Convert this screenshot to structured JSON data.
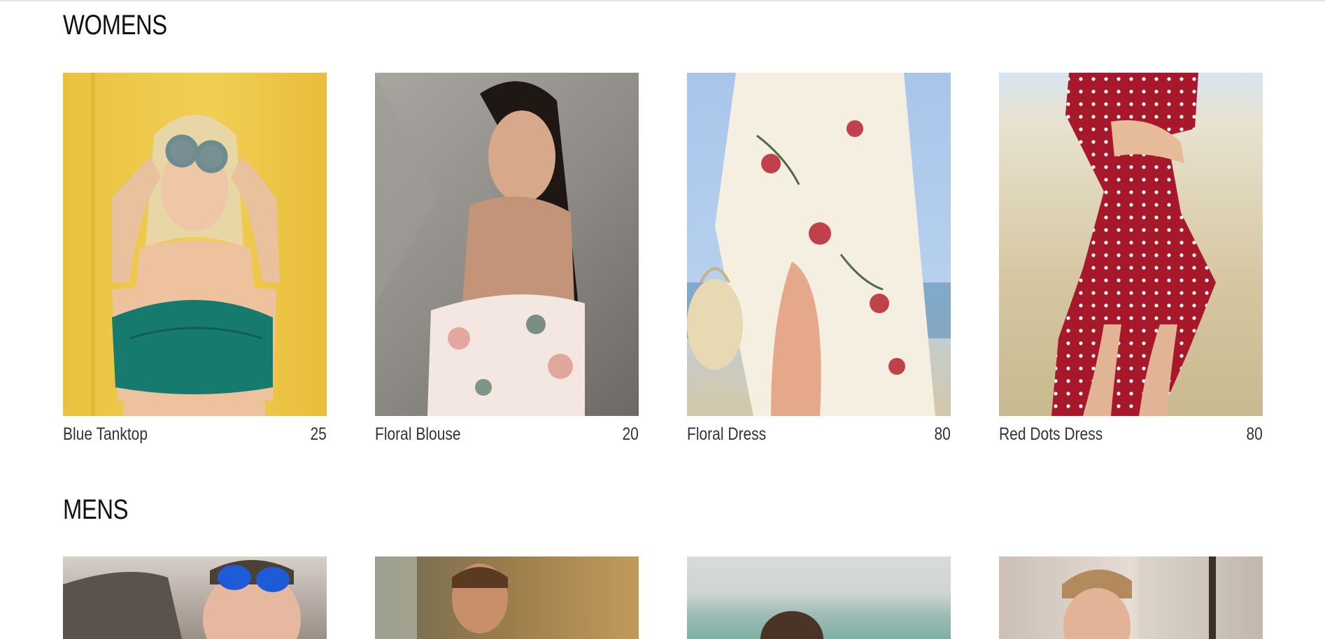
{
  "sections": {
    "womens": {
      "title": "WOMENS",
      "products": [
        {
          "name": "Blue Tanktop",
          "price": "25"
        },
        {
          "name": "Floral Blouse",
          "price": "20"
        },
        {
          "name": "Floral Dress",
          "price": "80"
        },
        {
          "name": "Red Dots Dress",
          "price": "80"
        }
      ]
    },
    "mens": {
      "title": "MENS"
    }
  }
}
